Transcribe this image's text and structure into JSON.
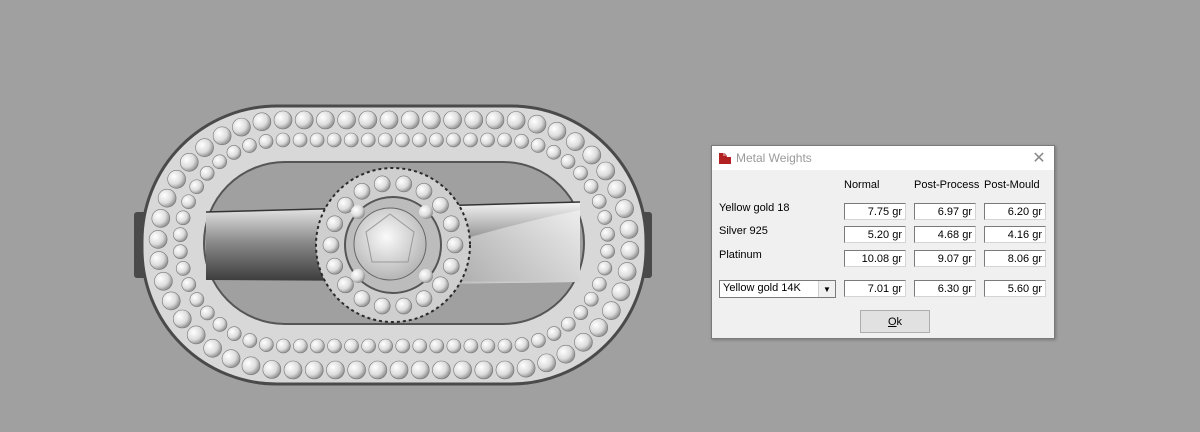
{
  "dialog": {
    "title": "Metal Weights",
    "close_glyph": "✕",
    "columns": [
      "Normal",
      "Post-Process",
      "Post-Mould"
    ],
    "rows": [
      {
        "label": "Yellow gold 18",
        "values": [
          "7.75 gr",
          "6.97 gr",
          "6.20 gr"
        ]
      },
      {
        "label": "Silver 925",
        "values": [
          "5.20 gr",
          "4.68 gr",
          "4.16 gr"
        ]
      },
      {
        "label": "Platinum",
        "values": [
          "10.08 gr",
          "9.07 gr",
          "8.06 gr"
        ]
      }
    ],
    "custom_row": {
      "selected_metal": "Yellow gold 14K",
      "values": [
        "7.01 gr",
        "6.30 gr",
        "5.60 gr"
      ]
    },
    "ok_label_first": "O",
    "ok_label_rest": "k"
  },
  "colors": {
    "background": "#a0a0a0",
    "dialog_bg": "#f0f0f0",
    "icon_red": "#b22222"
  },
  "icons": [
    "app-logo-icon",
    "close-icon",
    "dropdown-arrow-icon"
  ]
}
